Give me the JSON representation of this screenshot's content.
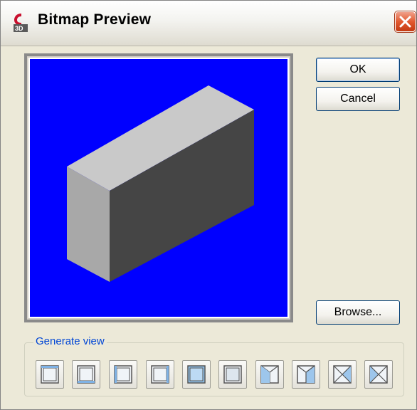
{
  "window": {
    "title": "Bitmap Preview",
    "icon": "civil3d-app-icon"
  },
  "colors": {
    "preview_background": "#0000ff",
    "box_top": "#c9c9c9",
    "box_front": "#a8a8a8",
    "box_right": "#454545",
    "group_label": "#0046d5"
  },
  "buttons": {
    "ok": "OK",
    "cancel": "Cancel",
    "browse": "Browse..."
  },
  "generate_view": {
    "label": "Generate view",
    "views": [
      "top-view-icon",
      "bottom-view-icon",
      "left-view-icon",
      "right-view-icon",
      "front-view-icon",
      "back-view-icon",
      "sw-isometric-icon",
      "se-isometric-icon",
      "ne-isometric-icon",
      "nw-isometric-icon"
    ]
  }
}
